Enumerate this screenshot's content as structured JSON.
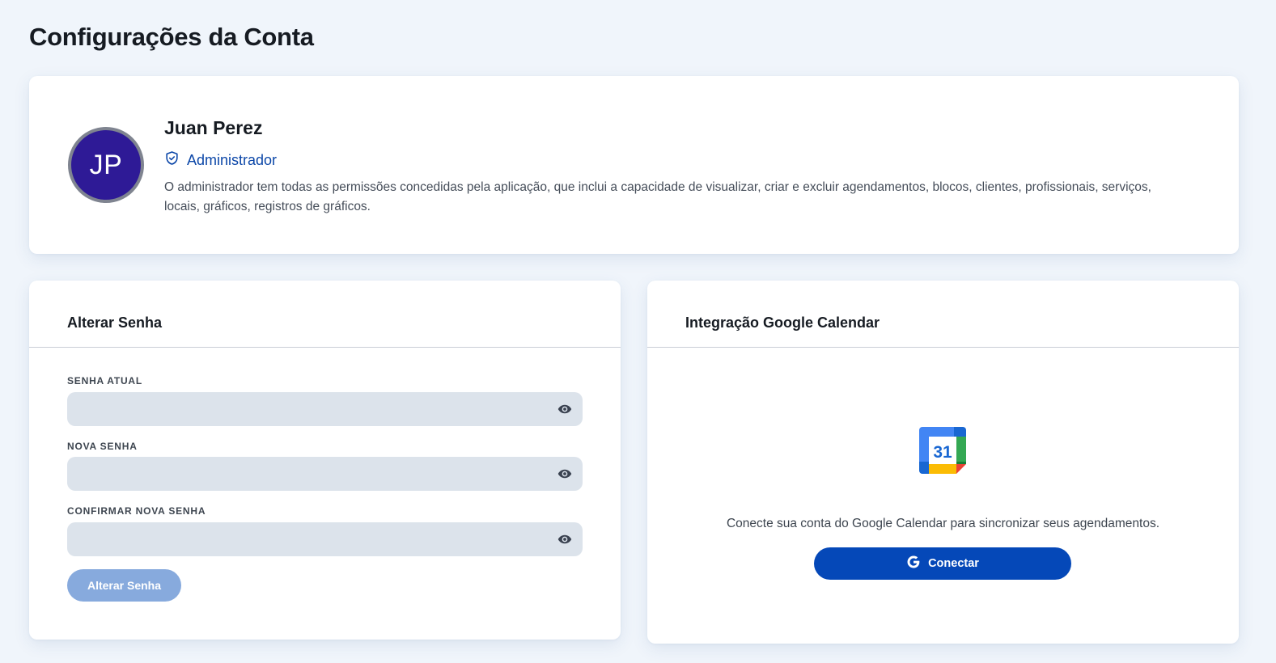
{
  "page": {
    "title": "Configurações da Conta"
  },
  "profile": {
    "initials": "JP",
    "name": "Juan Perez",
    "role": "Administrador",
    "role_icon": "shield-check-icon",
    "description": "O administrador tem todas as permissões concedidas pela aplicação, que inclui a capacidade de visualizar, criar e excluir agendamentos, blocos, clientes, profissionais, serviços, locais, gráficos, registros de gráficos.",
    "avatar_color": "#2e1a96"
  },
  "password": {
    "title": "Alterar Senha",
    "fields": [
      {
        "label": "SENHA ATUAL",
        "value": "",
        "icon": "eye-icon"
      },
      {
        "label": "NOVA SENHA",
        "value": "",
        "icon": "eye-icon"
      },
      {
        "label": "CONFIRMAR NOVA SENHA",
        "value": "",
        "icon": "eye-icon"
      }
    ],
    "submit_label": "Alterar Senha",
    "submit_color": "#87aadd"
  },
  "calendar": {
    "title": "Integração Google Calendar",
    "logo_day": "31",
    "description": "Conecte sua conta do Google Calendar para sincronizar seus agendamentos.",
    "connect_label": "Conectar",
    "connect_icon": "google-icon",
    "connect_color": "#0548b8"
  }
}
